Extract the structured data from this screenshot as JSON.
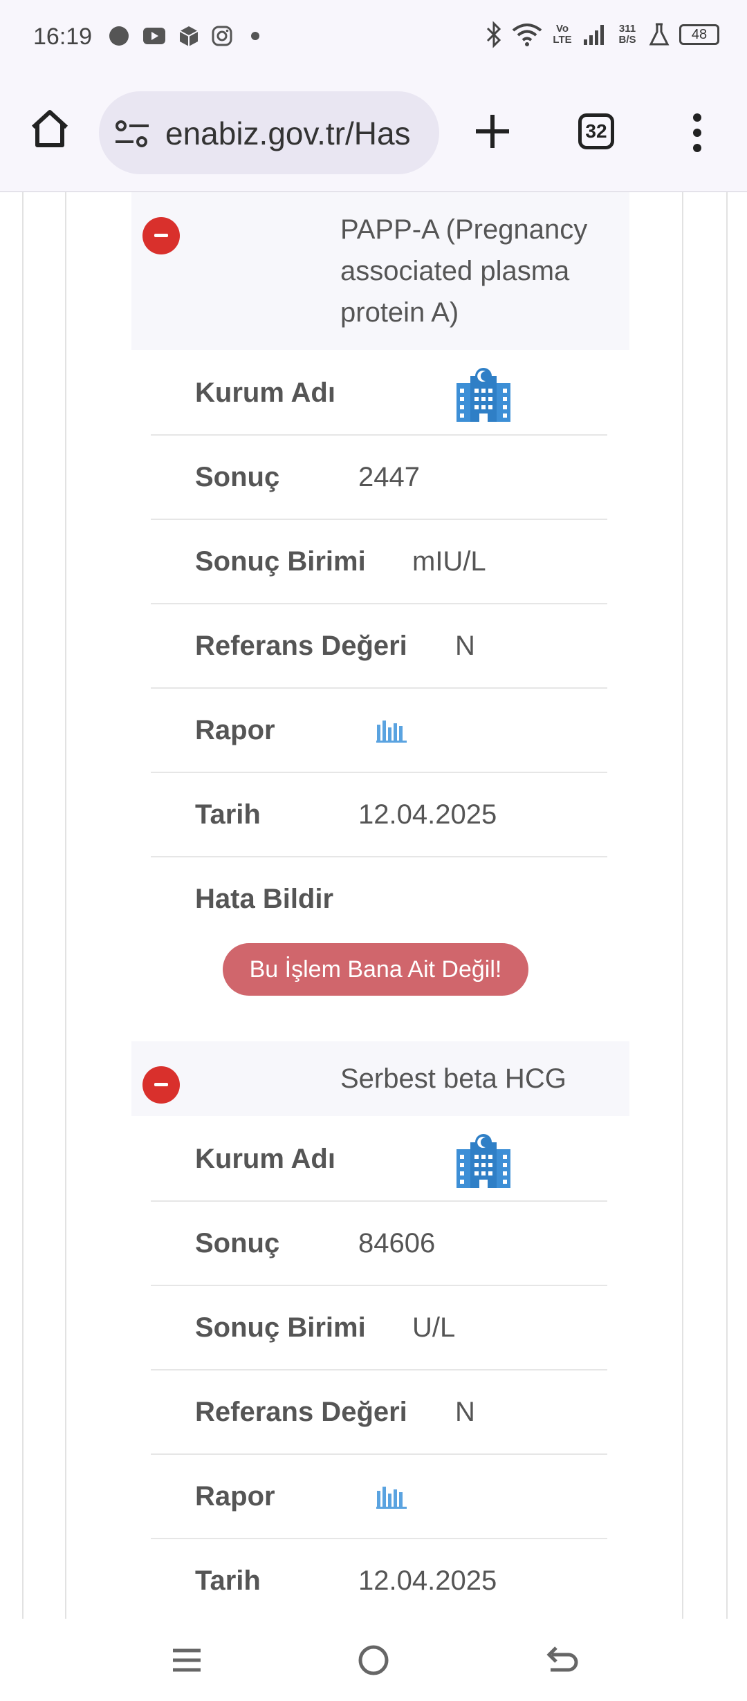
{
  "status_bar": {
    "time": "16:19",
    "network_speed": "311 B/S",
    "volte": "Vo LTE",
    "battery": "48",
    "icons": [
      "circle-icon",
      "youtube-icon",
      "package-icon",
      "instagram-icon",
      "dot-icon",
      "bluetooth-icon",
      "wifi-icon",
      "signal-icon",
      "flask-icon",
      "battery-icon"
    ]
  },
  "browser": {
    "url": "enabiz.gov.tr/Has",
    "tab_count": "32"
  },
  "tests": [
    {
      "name": "PAPP-A (Pregnancy associated plasma protein A)",
      "name_lines": [
        "PAPP-A (Pregnancy",
        "associated plasma",
        "protein A)"
      ],
      "rows": {
        "institution_label": "Kurum Adı",
        "result_label": "Sonuç",
        "result_value": "2447",
        "unit_label": "Sonuç Birimi",
        "unit_value": "mIU/L",
        "reference_label": "Referans Değeri",
        "reference_value": "N",
        "report_label": "Rapor",
        "date_label": "Tarih",
        "date_value": "12.04.2025",
        "error_label": "Hata Bildir",
        "error_button": "Bu İşlem Bana Ait Değil!"
      }
    },
    {
      "name": "Serbest beta HCG",
      "rows": {
        "institution_label": "Kurum Adı",
        "result_label": "Sonuç",
        "result_value": "84606",
        "unit_label": "Sonuç Birimi",
        "unit_value": "U/L",
        "reference_label": "Referans Değeri",
        "reference_value": "N",
        "report_label": "Rapor",
        "date_label": "Tarih",
        "date_value": "12.04.2025"
      }
    }
  ],
  "colors": {
    "collapse_button": "#d9302c",
    "report_button": "#d0666c",
    "icon_blue": "#3d8fd6"
  }
}
